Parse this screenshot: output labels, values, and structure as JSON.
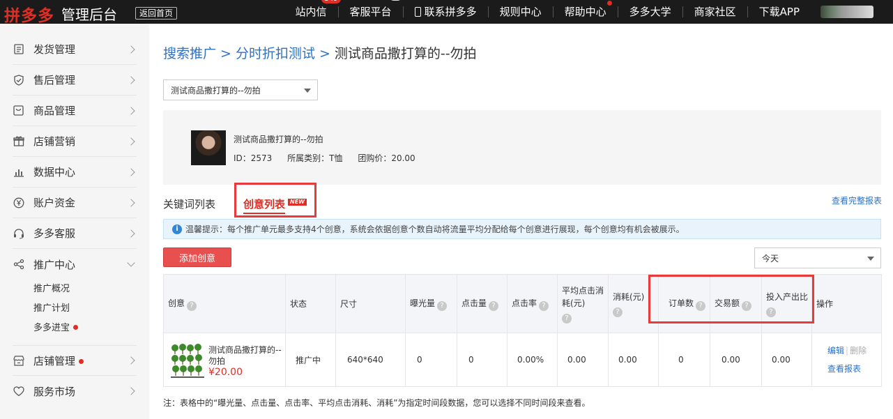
{
  "topbar": {
    "logo": "拼多多",
    "logo_sub": "管理后台",
    "back_home": "返回首页",
    "nav": [
      {
        "label": "站内信",
        "badge": "349"
      },
      {
        "label": "客服平台",
        "badge": "新"
      },
      {
        "label": "联系拼多多"
      },
      {
        "label": "规则中心"
      },
      {
        "label": "帮助中心"
      },
      {
        "label": "多多大学"
      },
      {
        "label": "商家社区"
      },
      {
        "label": "下载APP"
      }
    ]
  },
  "sidebar": {
    "items": [
      {
        "label": "发货管理"
      },
      {
        "label": "售后管理"
      },
      {
        "label": "商品管理"
      },
      {
        "label": "店铺营销"
      },
      {
        "label": "数据中心"
      },
      {
        "label": "账户资金"
      },
      {
        "label": "多多客服"
      },
      {
        "label": "推广中心"
      },
      {
        "label": "店铺管理"
      },
      {
        "label": "服务市场"
      }
    ],
    "sub_items": [
      {
        "label": "推广概况"
      },
      {
        "label": "推广计划"
      },
      {
        "label": "多多进宝"
      }
    ]
  },
  "breadcrumb": {
    "item1": "搜索推广",
    "item2": "分时折扣测试",
    "current": "测试商品撒打算的--勿拍",
    "sep": ">"
  },
  "unit_select": {
    "value": "测试商品撒打算的--勿拍"
  },
  "product": {
    "name": "测试商品撒打算的--勿拍",
    "id": "ID：2573",
    "category": "所属类别：T恤",
    "group_price": "团购价：20.00"
  },
  "tabs": {
    "keywords": "关键词列表",
    "creatives": "创意列表",
    "new_tag": "NEW",
    "full_report": "查看完整报表"
  },
  "tip": {
    "icon": "i",
    "text": "温馨提示：每个推广单元最多支持4个创意，系统会依据创意个数自动将流量平均分配给每个创意进行展现，每个创意均有机会被展示。"
  },
  "toolbar": {
    "add_creative": "添加创意",
    "date_range": "今天"
  },
  "table": {
    "headers": [
      "创意",
      "状态",
      "尺寸",
      "曝光量",
      "点击量",
      "点击率",
      "平均点击消耗(元)",
      "消耗(元)",
      "订单数",
      "交易额",
      "投入产出比",
      "操作"
    ],
    "row": {
      "name": "测试商品撒打算的--勿拍",
      "price": "¥20.00",
      "status": "推广中",
      "size": "640*640",
      "impressions": "0",
      "clicks": "0",
      "ctr": "0.00%",
      "avg_cpc": "0.00",
      "spend": "0.00",
      "orders": "0",
      "gmv": "0.00",
      "roi": "0.00",
      "edit": "编辑",
      "delete": "删除",
      "report": "查看报表"
    }
  },
  "note": "注：表格中的“曝光量、点击量、点击率、平均点击消耗、消耗”为指定时间段数据，您可以选择不同时间段来查看。",
  "colors": {
    "accent": "#e02e24",
    "link": "#2f72c4",
    "highlight": "#e83a3a"
  }
}
